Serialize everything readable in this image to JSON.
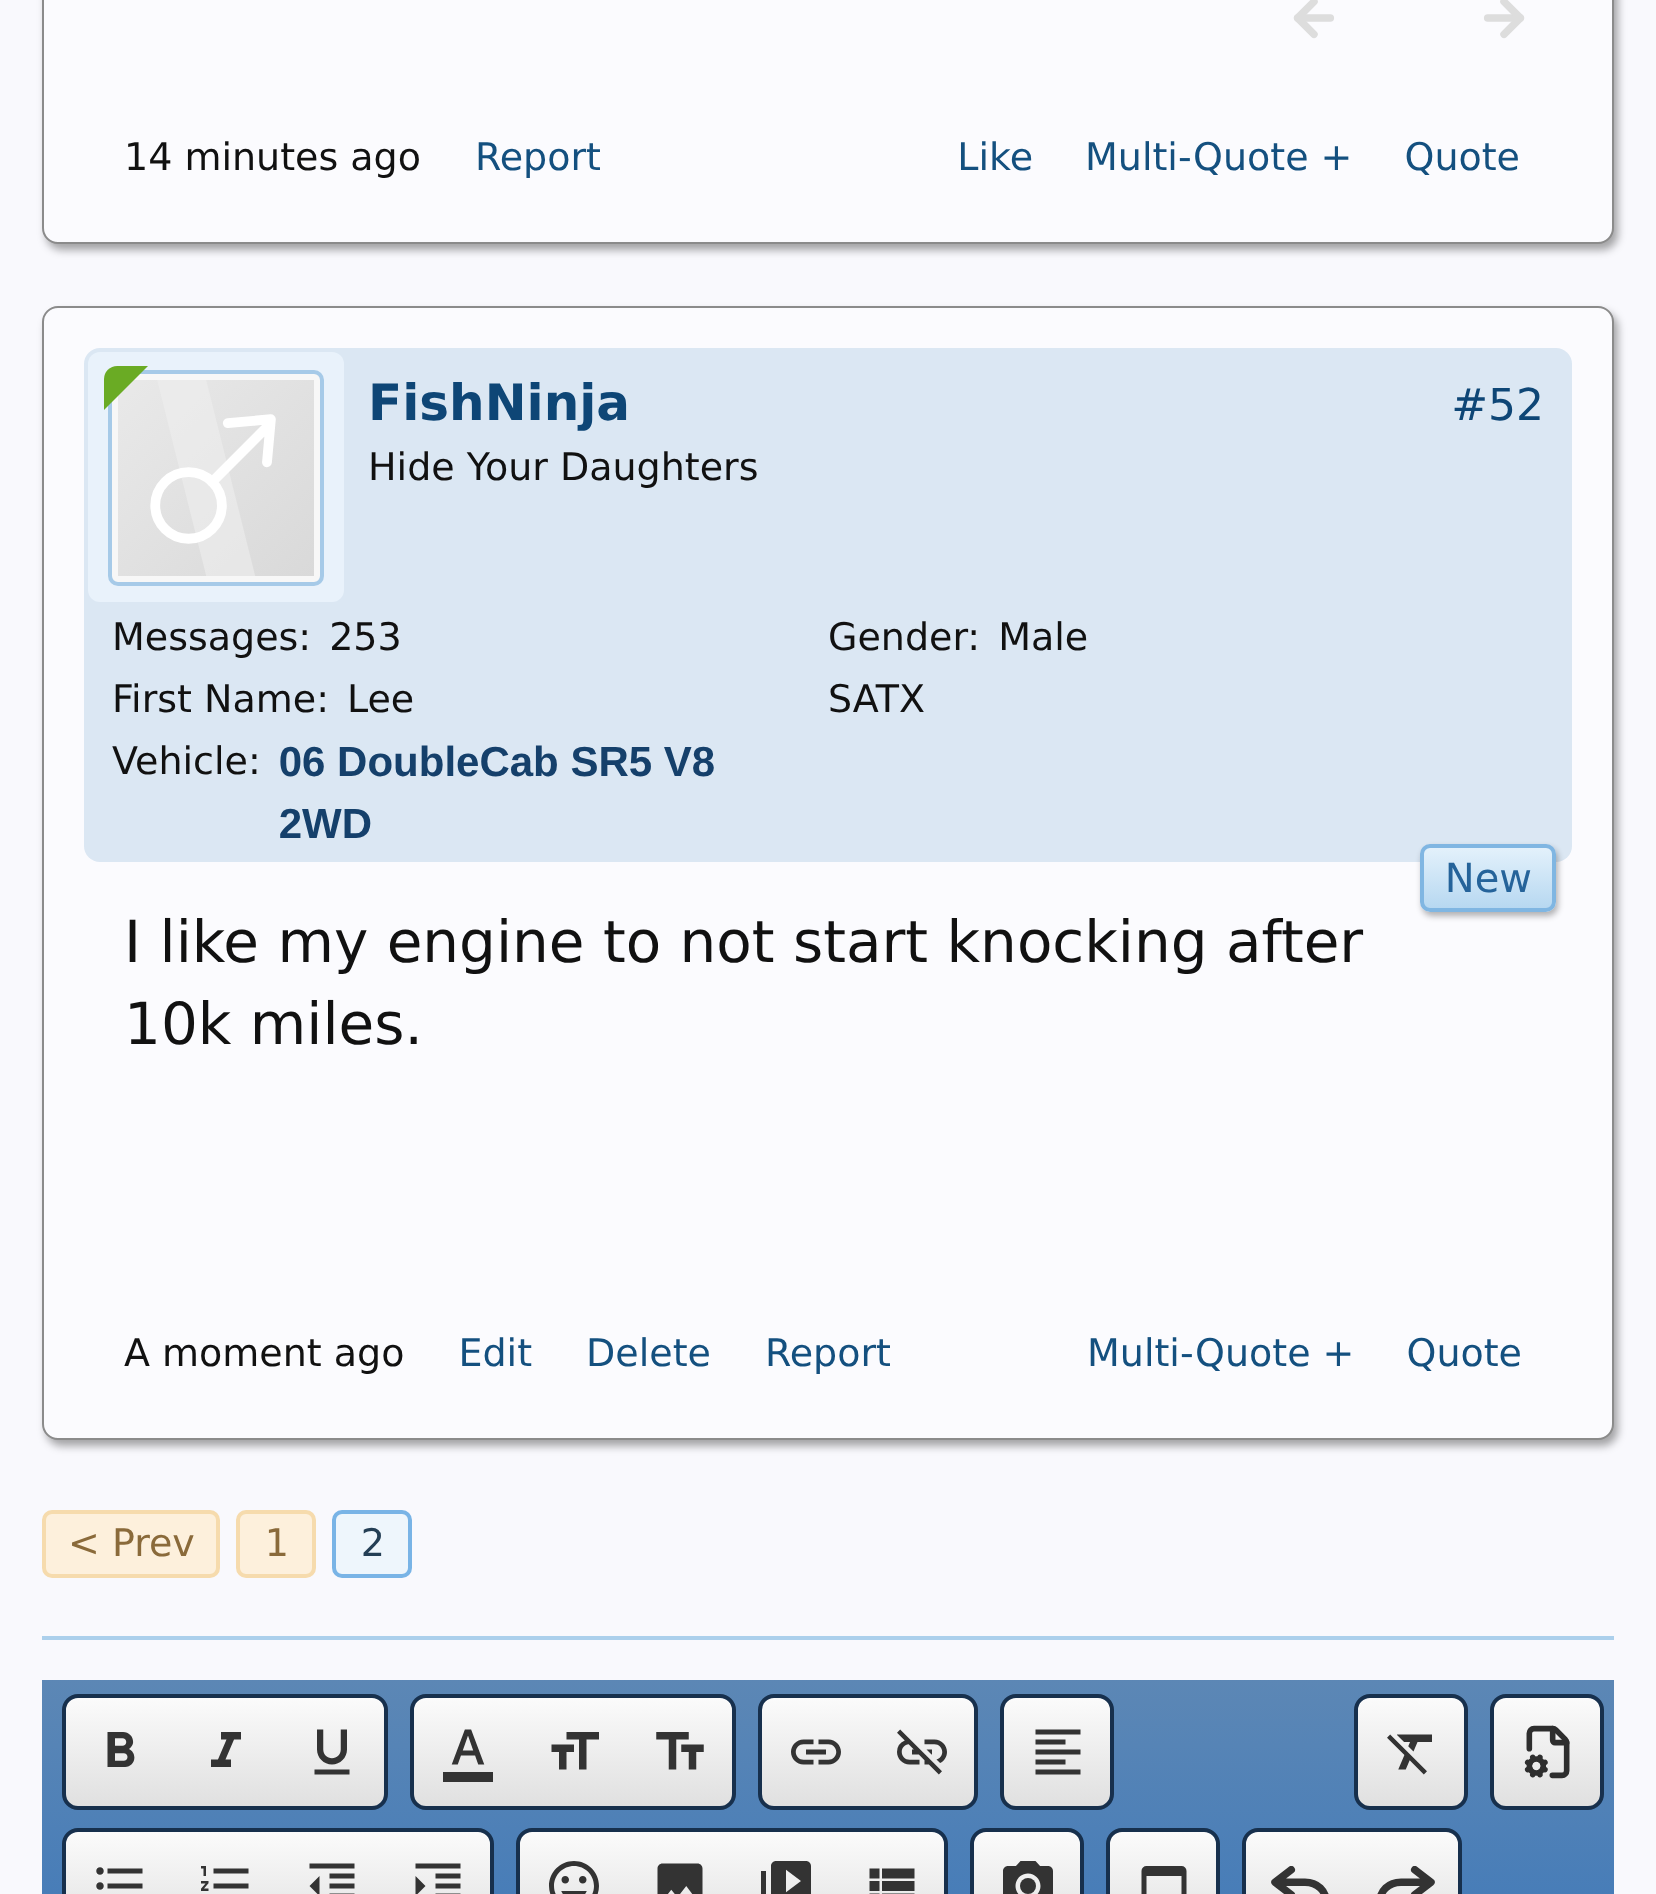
{
  "previous_post": {
    "time": "14 minutes ago",
    "links_left": [
      "Report"
    ],
    "links_right": [
      "Like",
      "Multi-Quote +",
      "Quote"
    ]
  },
  "post": {
    "username": "FishNinja",
    "user_title": "Hide Your Daughters",
    "post_number": "#52",
    "online": true,
    "details_left": [
      {
        "label": "Messages:",
        "value": "253",
        "kind": "plain"
      },
      {
        "label": "First Name:",
        "value": "Lee",
        "kind": "plain"
      },
      {
        "label": "Vehicle:",
        "value": "06 DoubleCab SR5 V8 2WD",
        "kind": "emphasis"
      }
    ],
    "details_right": [
      {
        "label": "Gender:",
        "value": "Male",
        "kind": "plain"
      },
      {
        "value": "SATX",
        "kind": "plain"
      }
    ],
    "badge": "New",
    "message": "I like my engine to not start knocking after 10k miles.",
    "time": "A moment ago",
    "links_left": [
      "Edit",
      "Delete",
      "Report"
    ],
    "links_right": [
      "Multi-Quote +",
      "Quote"
    ]
  },
  "pagination": [
    {
      "label": "< Prev",
      "selected": false
    },
    {
      "label": "1",
      "selected": false
    },
    {
      "label": "2",
      "selected": true
    }
  ]
}
